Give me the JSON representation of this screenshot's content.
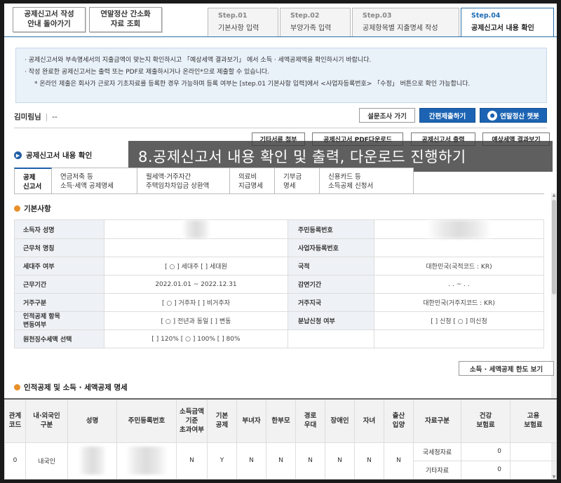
{
  "top_buttons": {
    "back": "공제신고서 작성\n안내 돌아가기",
    "lookup": "연말정산 간소화\n자료 조회"
  },
  "steps": [
    {
      "num": "Step.01",
      "label": "기본사항 입력"
    },
    {
      "num": "Step.02",
      "label": "부양가족 입력"
    },
    {
      "num": "Step.03",
      "label": "공제항목별 지출명세 작성"
    },
    {
      "num": "Step.04",
      "label": "공제신고서 내용 확인"
    }
  ],
  "notice": {
    "line1": "공제신고서와 부속명세서의 지출금액이 맞는지 확인하시고 「예상세액 결과보기」 에서 소득 · 세액공제액을 확인하시기 바랍니다.",
    "line2": "작성 완료한 공제신고서는 출력 또는 PDF로 제출하시거나 온라인*으로 제출할 수 있습니다.",
    "line3": "* 온라인 제출은 회사가 근로자 기초자료를 등록한 경우 가능하며 등록 여부는 [step.01 기본사항 입력]에서 <사업자등록번호> 「수정」 버튼으로 확인 가능합니다."
  },
  "user": {
    "name": "김미림님",
    "value": "--"
  },
  "right_buttons": {
    "survey": "설문조사 가기",
    "simple_submit": "간편제출하기",
    "chatbot": "연말정산 챗봇"
  },
  "action_buttons": [
    "기타서류 첨부",
    "공제신고서 PDF다운로드",
    "공제신고서 출력",
    "예상세액 결과보기"
  ],
  "section_title": "공제신고서 내용 확인",
  "overlay_caption": "8.공제신고서 내용 확인 및 출력, 다운로드 진행하기",
  "tabs": [
    "공제\n신고서",
    "연금저축 등\n소득·세액 공제명세",
    "월세액·거주자간\n주택임차차입금 상환액",
    "의료비\n지급명세",
    "기부금\n명세",
    "신용카드 등\n소득공제 신청서"
  ],
  "basic": {
    "title": "기본사항",
    "rows": [
      {
        "h1": "소득자 성명",
        "v1": "",
        "h2": "주민등록번호",
        "v2": ""
      },
      {
        "h1": "근무처 명칭",
        "v1": "",
        "h2": "사업자등록번호",
        "v2": ""
      },
      {
        "h1": "세대주 여부",
        "v1": "[ ○ ] 세대주  [    ] 세대원",
        "h2": "국적",
        "v2": "대한민국(국적코드 : KR)"
      },
      {
        "h1": "근무기간",
        "v1": "2022.01.01 ~ 2022.12.31",
        "h2": "감면기간",
        "v2": ". . ~ . ."
      },
      {
        "h1": "거주구분",
        "v1": "[ ○ ] 거주자  [    ] 비거주자",
        "h2": "거주지국",
        "v2": "대한민국(거주지코드 : KR)"
      },
      {
        "h1": "인적공제 항목\n변동여부",
        "v1": "[ ○ ] 전년과 동일  [    ] 변동",
        "h2": "분납신청 여부",
        "v2": "[    ] 신청 [ ○ ] 미신청"
      },
      {
        "h1": "원천징수세액 선택",
        "v1": "[    ] 120%  [ ○ ] 100%  [    ] 80%",
        "h2": "",
        "v2": ""
      }
    ]
  },
  "limit_button": "소득 · 세액공제 한도 보기",
  "deduction": {
    "title": "인적공제 및 소득 · 세액공제 명세",
    "headers": [
      "관계\n코드",
      "내·외국인\n구분",
      "성명",
      "주민등록번호",
      "소득금액\n기준\n초과여부",
      "기본\n공제",
      "부녀자",
      "한부모",
      "경로\n우대",
      "장애인",
      "자녀",
      "출산\n입양",
      "자료구분",
      "건강\n보험료",
      "고용\n보험료"
    ],
    "row": {
      "code": "0",
      "type": "내국인",
      "name": "",
      "rrn": "",
      "over": "N",
      "basic": "Y",
      "woman": "N",
      "single": "N",
      "elder": "N",
      "disabled": "N",
      "child": "N",
      "birth": "N",
      "src1": "국세청자료",
      "health1": "0",
      "src2": "기타자료",
      "health2": "0"
    }
  }
}
